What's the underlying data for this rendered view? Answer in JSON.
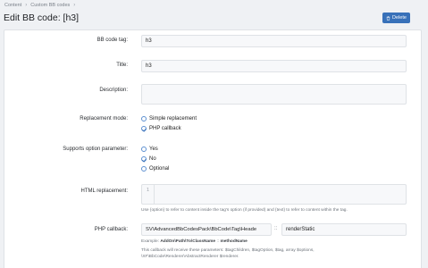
{
  "breadcrumb": [
    "Content",
    "Custom BB codes"
  ],
  "page_title": "Edit BB code: [h3]",
  "delete_label": "Delete",
  "fields": {
    "tag_label": "BB code tag:",
    "tag_value": "h3",
    "title_label": "Title:",
    "title_value": "h3",
    "description_label": "Description:",
    "description_value": "",
    "replacement_mode_label": "Replacement mode:",
    "replacement_mode_options": [
      "Simple replacement",
      "PHP callback"
    ],
    "replacement_mode_selected": "PHP callback",
    "option_param_label": "Supports option parameter:",
    "option_param_options": [
      "Yes",
      "No",
      "Optional"
    ],
    "option_param_selected": "No",
    "html_replacement_label": "HTML replacement:",
    "html_line_number": "1",
    "html_hint": "Use {option} to refer to content inside the tag's option (if provided) and {text} to refer to content within the tag.",
    "php_callback_label": "PHP callback:",
    "php_class_value": "SV\\AdvancedBbCodesPack\\BbCode\\Tag\\Heade",
    "php_colon": "::",
    "php_method_value": "renderStatic",
    "php_example_prefix": "Example:",
    "php_example_class": "AddOn\\Path\\To\\ClassName",
    "php_example_sep": "::",
    "php_example_method": "methodName",
    "php_hint_1": "This callback will receive these parameters: $tagChildren, $tagOption, $tag, array $options,",
    "php_hint_2": "\\XF\\BbCode\\Renderer\\AbstractRenderer $renderer."
  },
  "colors": {
    "accent": "#3871b9",
    "background": "#eff1f4",
    "panel": "#ffffff",
    "input_bg": "#f7f8fa"
  },
  "icons": {
    "delete": "trash-icon",
    "radio_checked": "check-icon"
  }
}
